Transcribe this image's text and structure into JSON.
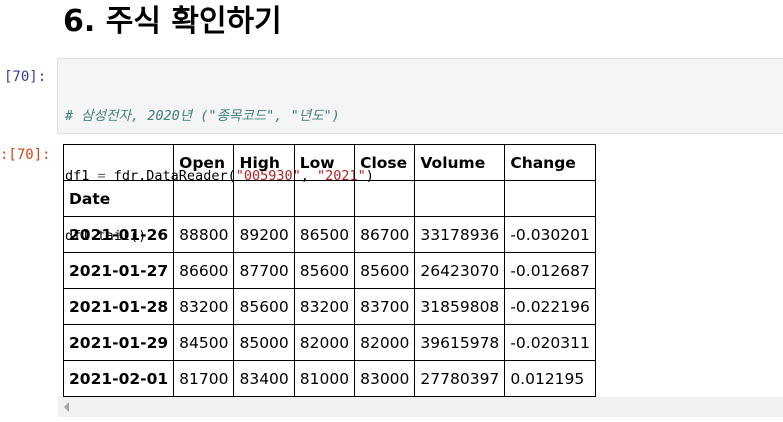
{
  "heading": "6. 주식 확인하기",
  "input_prompt": "[70]:",
  "output_prompt": ":[70]:",
  "code": {
    "comment": "# 삼성전자, 2020년 (\"종목코드\", \"년도\")",
    "line2": {
      "pre": "df1 ",
      "eq": "=",
      "mid": " fdr.DataReader(",
      "arg1": "\"005930\"",
      "sep": ", ",
      "arg2": "\"2021\"",
      "post": ")"
    },
    "line3": "df1.tail()"
  },
  "table": {
    "columns": [
      "Open",
      "High",
      "Low",
      "Close",
      "Volume",
      "Change"
    ],
    "index_name": "Date",
    "rows": [
      {
        "date": "2021-01-26",
        "values": [
          "88800",
          "89200",
          "86500",
          "86700",
          "33178936",
          "-0.030201"
        ]
      },
      {
        "date": "2021-01-27",
        "values": [
          "86600",
          "87700",
          "85600",
          "85600",
          "26423070",
          "-0.012687"
        ]
      },
      {
        "date": "2021-01-28",
        "values": [
          "83200",
          "85600",
          "83200",
          "83700",
          "31859808",
          "-0.022196"
        ]
      },
      {
        "date": "2021-01-29",
        "values": [
          "84500",
          "85000",
          "82000",
          "82000",
          "39615978",
          "-0.020311"
        ]
      },
      {
        "date": "2021-02-01",
        "values": [
          "81700",
          "83400",
          "81000",
          "83000",
          "27780397",
          "0.012195"
        ]
      }
    ]
  }
}
